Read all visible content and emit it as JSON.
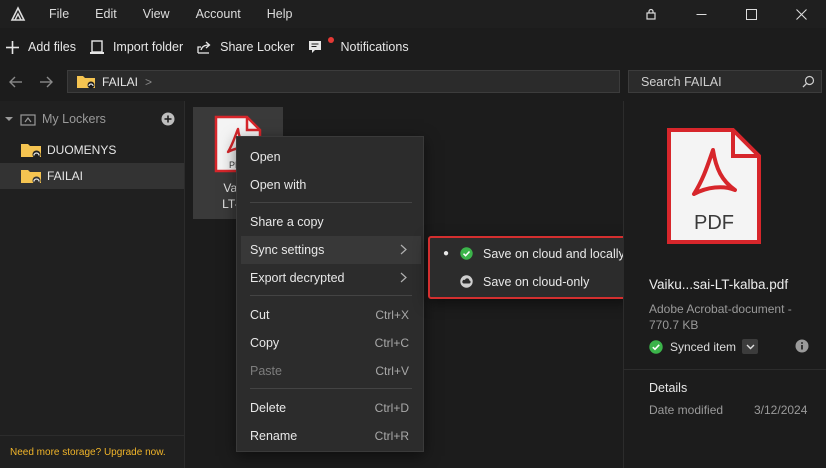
{
  "menubar": {
    "items": [
      "File",
      "Edit",
      "View",
      "Account",
      "Help"
    ]
  },
  "toolbar": {
    "add_files": "Add files",
    "import_folder": "Import folder",
    "share_locker": "Share Locker",
    "notifications": "Notifications"
  },
  "address": {
    "crumb": "FAILAI",
    "separator": ">"
  },
  "search": {
    "placeholder": "Search FAILAI"
  },
  "sidebar": {
    "header": "My Lockers",
    "items": [
      {
        "label": "DUOMENYS"
      },
      {
        "label": "FAILAI"
      }
    ],
    "footer": "Need more storage? Upgrade now."
  },
  "file": {
    "name_line1": "Vaiku",
    "name_line2": "LT-kal"
  },
  "context_menu": {
    "open": "Open",
    "open_with": "Open with",
    "share_copy": "Share a copy",
    "sync_settings": "Sync settings",
    "export_decrypted": "Export decrypted",
    "cut": "Cut",
    "cut_shortcut": "Ctrl+X",
    "copy": "Copy",
    "copy_shortcut": "Ctrl+C",
    "paste": "Paste",
    "paste_shortcut": "Ctrl+V",
    "delete": "Delete",
    "delete_shortcut": "Ctrl+D",
    "rename": "Rename",
    "rename_shortcut": "Ctrl+R"
  },
  "submenu": {
    "cloud_and_local": "Save on cloud and locally",
    "cloud_only": "Save on cloud-only",
    "selected_bullet": "●"
  },
  "details": {
    "pdf_label": "PDF",
    "filename": "Vaiku...sai-LT-kalba.pdf",
    "type": "Adobe Acrobat-document -",
    "size": "770.7 KB",
    "sync_status": "Synced item",
    "heading": "Details",
    "date_label": "Date modified",
    "date_value": "3/12/2024"
  },
  "colors": {
    "accent_red": "#d32f2f",
    "sync_green": "#3bb44a",
    "upgrade_yellow": "#f0b429",
    "folder_yellow": "#f5c451"
  }
}
